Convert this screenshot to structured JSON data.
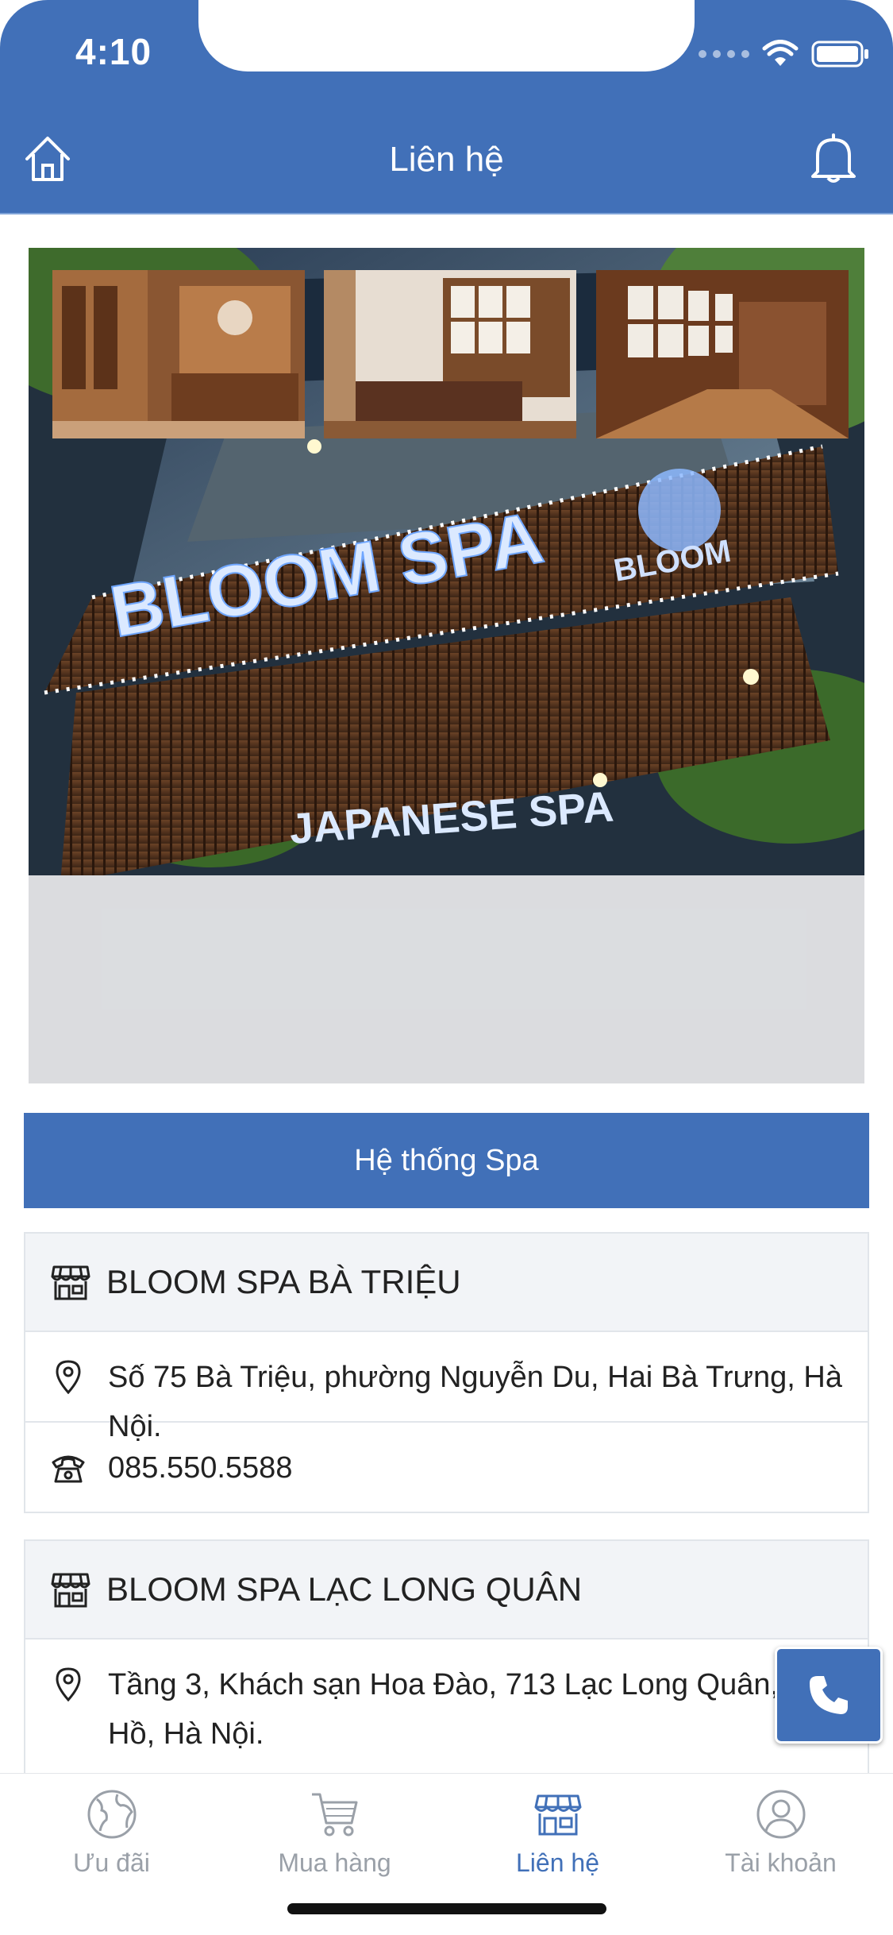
{
  "status_bar": {
    "time": "4:10"
  },
  "header": {
    "title": "Liên hệ"
  },
  "gallery": {
    "main_image": "bloom-spa-storefront",
    "thumbnails": [
      "reception-room",
      "treatment-room",
      "corridor"
    ]
  },
  "section": {
    "title": "Hệ thống Spa"
  },
  "stores": [
    {
      "name": "BLOOM SPA BÀ TRIỆU",
      "address": "Số 75 Bà Triệu, phường Nguyễn Du, Hai Bà Trưng, Hà Nội.",
      "phone": "085.550.5588"
    },
    {
      "name": "BLOOM SPA LẠC LONG QUÂN",
      "address": "Tầng 3, Khách sạn Hoa Đào, 713 Lạc Long Quân, Tây Hồ, Hà Nội."
    }
  ],
  "tabbar": {
    "tabs": [
      {
        "label": "Ưu đãi",
        "icon": "globe-icon"
      },
      {
        "label": "Mua hàng",
        "icon": "cart-icon"
      },
      {
        "label": "Liên hệ",
        "icon": "store-icon"
      },
      {
        "label": "Tài khoản",
        "icon": "user-icon"
      }
    ],
    "active_tab": "Liên hệ"
  },
  "colors": {
    "primary": "#4170b8",
    "inactive": "#9aa0a8",
    "card_header_bg": "#f2f4f7"
  }
}
